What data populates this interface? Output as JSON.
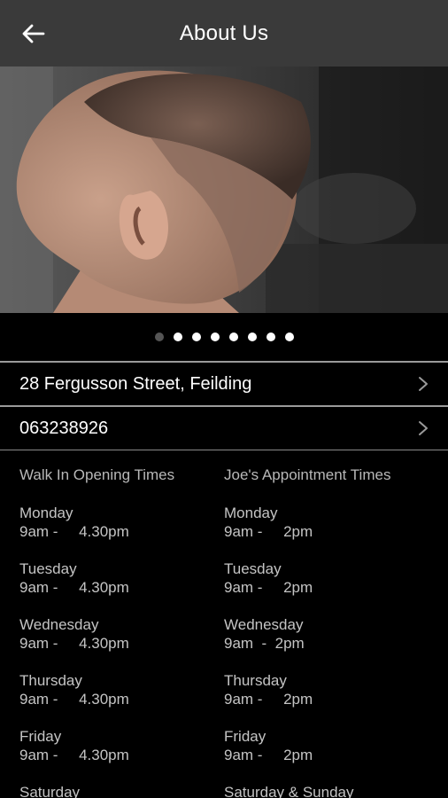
{
  "header": {
    "title": "About Us",
    "back_icon": "arrow-left-icon"
  },
  "carousel": {
    "dot_count": 8,
    "active_index": 0
  },
  "contact": {
    "address": "28 Fergusson Street, Feilding",
    "phone": "063238926",
    "chevron_icon": "chevron-right-icon"
  },
  "walk_in": {
    "heading": "Walk In Opening Times",
    "items": [
      {
        "day": "Monday",
        "time": "9am -     4.30pm"
      },
      {
        "day": "Tuesday",
        "time": "9am -     4.30pm"
      },
      {
        "day": "Wednesday",
        "time": "9am -     4.30pm"
      },
      {
        "day": "Thursday",
        "time": "9am -     4.30pm"
      },
      {
        "day": "Friday",
        "time": "9am -     4.30pm"
      },
      {
        "day": "Saturday",
        "time": ""
      }
    ]
  },
  "appointments": {
    "heading": "Joe's Appointment Times",
    "items": [
      {
        "day": "Monday",
        "time": "9am -     2pm"
      },
      {
        "day": "Tuesday",
        "time": "9am -     2pm"
      },
      {
        "day": "Wednesday",
        "time": "9am  -  2pm"
      },
      {
        "day": "Thursday",
        "time": "9am -     2pm"
      },
      {
        "day": "Friday",
        "time": "9am -     2pm"
      },
      {
        "day": "Saturday & Sunday",
        "time": ""
      }
    ]
  }
}
